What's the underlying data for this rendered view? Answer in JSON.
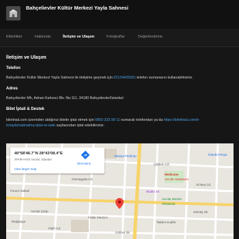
{
  "header": {
    "title": "Bahçelievler Kültür Merkezi Yayla Sahnesi"
  },
  "tabs": [
    {
      "label": "Etkinlikler"
    },
    {
      "label": "Hakkında"
    },
    {
      "label": "İletişim ve Ulaşım"
    },
    {
      "label": "Fotoğraflar"
    },
    {
      "label": "Değerlendirme"
    }
  ],
  "section_title": "İletişim ve Ulaşım",
  "phone": {
    "heading": "Telefon",
    "text_before": "Bahçelievler Kültür Merkezi Yayla Sahnesi ile iletişime geçmek için ",
    "number": "02124425051",
    "text_after": " telefon numarasını kullanabilirsiniz."
  },
  "address": {
    "heading": "Adres",
    "text": "Bahçelievler Mh, Adnan Kahveci Blv. No:111, 34180 Bahçelievler/İstanbul"
  },
  "refund": {
    "heading": "Bilet İptali & Destek",
    "line1_before": "biletinial.com üzerinden aldığınız biletin iptal etmek için ",
    "line1_phone": "0850 333 99 11",
    "line1_mid": " numaralı telefondan ya da ",
    "line1_link": "https://biletinial.com/tr-",
    "line2_link": "tr/sayfa/satinalma-iptal-ve-iade",
    "line2_after": " sayfasından iptal edebilirsiniz."
  },
  "map": {
    "coords": "40°58'46.7\"N 28°43'08.4\"E",
    "plus_code": "XPHR+HVS Avcılar, İstanbul",
    "larger_map": "View larger map",
    "directions": "Directions",
    "labels": [
      {
        "text": "Akasya Perşhop",
        "color": "#1a73e8"
      },
      {
        "text": "Çiğdem Cd.",
        "color": "#555555"
      },
      {
        "text": "İstanbul Rüya",
        "color": "#1a73e8"
      },
      {
        "text": "Medicane",
        "color": "#d93025"
      },
      {
        "text": "Avcılar Hastanesi",
        "color": "#d93025"
      },
      {
        "text": "Studio 24",
        "color": "#9334e6"
      },
      {
        "text": "Avcılar Merkez",
        "color": "#1e8e3e"
      },
      {
        "text": "Ortaokulu",
        "color": "#1e8e3e"
      },
      {
        "text": "Gümüşpala Cd.",
        "color": "#555555"
      },
      {
        "text": "Avcılar Çarşı",
        "color": "#555555"
      },
      {
        "text": "Forum Halkalı",
        "color": "#555555"
      },
      {
        "text": "Reşitpaşa",
        "color": "#555555"
      },
      {
        "text": "Taksim Kuaför",
        "color": "#555555"
      },
      {
        "text": "Gümüş Sk.",
        "color": "#555555"
      },
      {
        "text": "Kültür Merkezi",
        "color": "#555555"
      },
      {
        "text": "Fatih Cd.",
        "color": "#555555"
      },
      {
        "text": "Ali Bey Cd.",
        "color": "#555555"
      },
      {
        "text": "Gülizar Sk.",
        "color": "#555555"
      }
    ]
  },
  "colors": {
    "link": "#4ea3e6",
    "pin": "#ea4335",
    "road_yellow": "#f7d36a"
  }
}
